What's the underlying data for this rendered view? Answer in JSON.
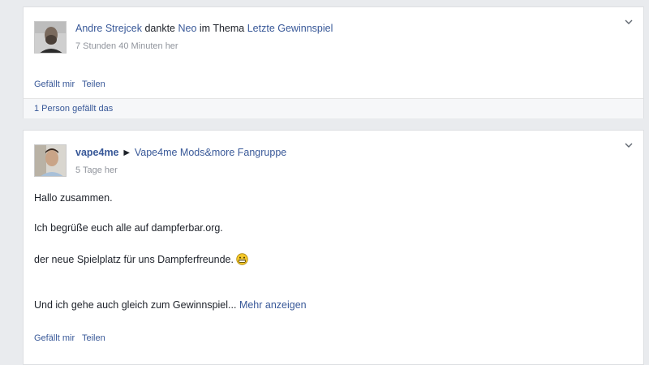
{
  "post1": {
    "author": "Andre Strejcek",
    "verb": "dankte",
    "target_user": "Neo",
    "in_thread": "im Thema",
    "thread": "Letzte Gewinnspiel",
    "time": "7 Stunden 40 Minuten her",
    "like_label": "Gefällt mir",
    "share_label": "Teilen",
    "likes_summary": "1 Person gefällt das"
  },
  "post2": {
    "author": "vape4me",
    "arrow": "►",
    "group": "Vape4me Mods&more Fangruppe",
    "time": "5 Tage her",
    "line1": "Hallo zusammen.",
    "line2": "Ich begrüße euch alle auf dampferbar.org.",
    "line3": "der neue Spielplatz für uns Dampferfreunde.",
    "line4": "Und ich gehe auch gleich zum Gewinnspiel...",
    "more_label": "Mehr anzeigen",
    "like_label": "Gefällt mir",
    "share_label": "Teilen"
  },
  "colors": {
    "link": "#385898",
    "muted": "#90949c",
    "background": "#e9ebee"
  },
  "icons": [
    "chevron-down-icon",
    "smiley-icon"
  ]
}
